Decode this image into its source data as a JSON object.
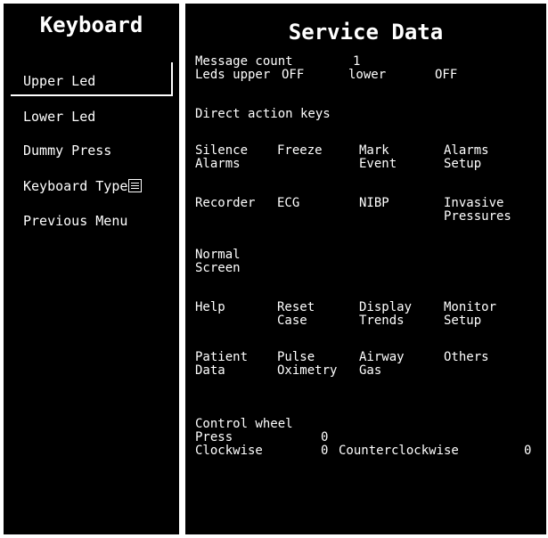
{
  "keyboard": {
    "title": "Keyboard",
    "items": [
      "Upper Led",
      "Lower Led",
      "Dummy Press",
      "Keyboard Type",
      "Previous Menu"
    ]
  },
  "service": {
    "title": "Service Data",
    "message_count_label": "Message count",
    "message_count_value": "1",
    "leds_upper_label": "Leds upper",
    "leds_upper_value": "OFF",
    "lower_label": "lower",
    "lower_value": "OFF",
    "direct_action_label": "Direct action keys",
    "keys": [
      [
        "Silence",
        "Alarms"
      ],
      [
        "Freeze",
        ""
      ],
      [
        "Mark",
        "Event"
      ],
      [
        "Alarms",
        "Setup"
      ],
      [
        "Recorder",
        ""
      ],
      [
        "ECG",
        ""
      ],
      [
        "NIBP",
        ""
      ],
      [
        "Invasive",
        "Pressures"
      ],
      [
        "Normal",
        "Screen"
      ],
      [
        "Help",
        ""
      ],
      [
        "Reset",
        "Case"
      ],
      [
        "Display",
        "Trends"
      ],
      [
        "Monitor",
        "Setup"
      ],
      [
        "Patient",
        "Data"
      ],
      [
        "Pulse",
        "Oximetry"
      ],
      [
        "Airway",
        "Gas"
      ],
      [
        "Others",
        ""
      ]
    ],
    "control_wheel_label": "Control wheel",
    "press_label": "Press",
    "press_value": "0",
    "clockwise_label": "Clockwise",
    "clockwise_value": "0",
    "counterclockwise_label": "Counterclockwise",
    "counterclockwise_value": "0"
  }
}
